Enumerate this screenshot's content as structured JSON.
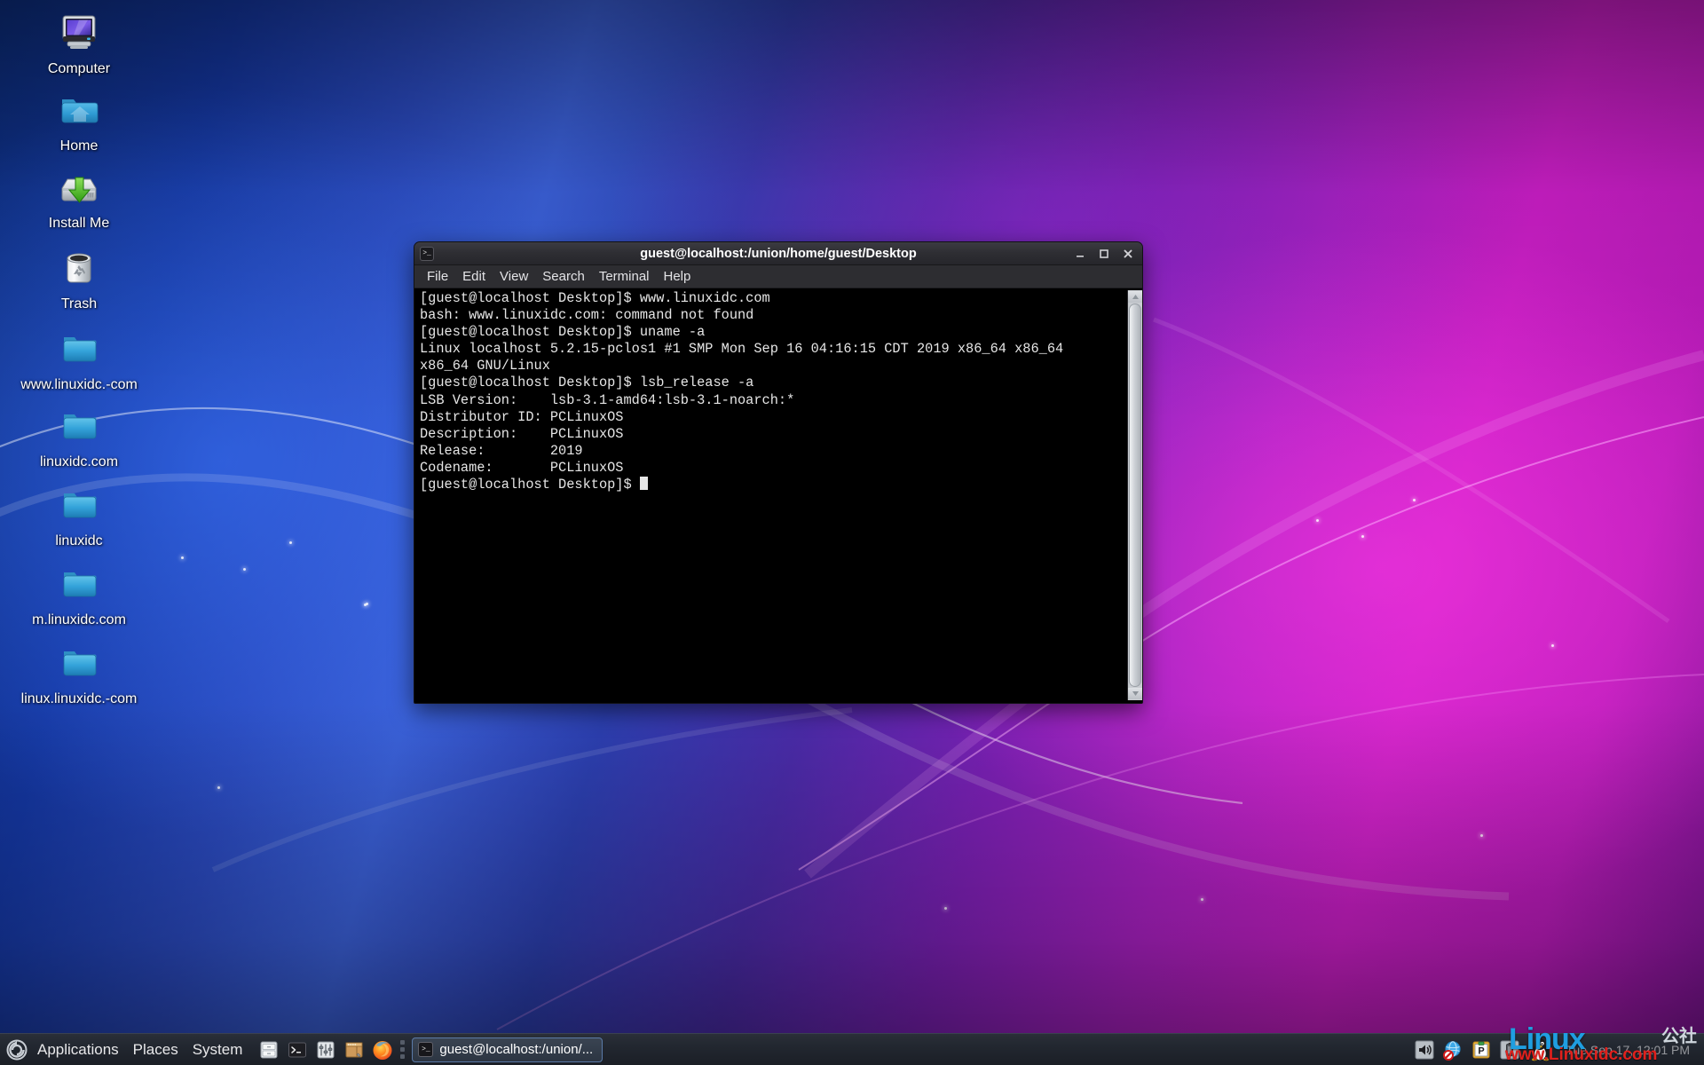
{
  "desktop": {
    "icons": [
      {
        "label": "Computer",
        "icon": "computer-monitor-icon"
      },
      {
        "label": "Home",
        "icon": "home-folder-icon"
      },
      {
        "label": "Install Me",
        "icon": "install-harddrive-icon"
      },
      {
        "label": "Trash",
        "icon": "trash-bin-icon"
      },
      {
        "label": "www.linuxidc.-com",
        "icon": "folder-icon"
      },
      {
        "label": "linuxidc.com",
        "icon": "folder-icon"
      },
      {
        "label": "linuxidc",
        "icon": "folder-icon"
      },
      {
        "label": "m.linuxidc.com",
        "icon": "folder-icon"
      },
      {
        "label": "linux.linuxidc.-com",
        "icon": "folder-icon"
      }
    ]
  },
  "terminal": {
    "title": "guest@localhost:/union/home/guest/Desktop",
    "window_icon": "terminal-icon",
    "titlebar_buttons": [
      {
        "name": "minimize",
        "glyph": "_"
      },
      {
        "name": "maximize",
        "glyph": "□"
      },
      {
        "name": "close",
        "glyph": "✕"
      }
    ],
    "menu": [
      "File",
      "Edit",
      "View",
      "Search",
      "Terminal",
      "Help"
    ],
    "content": "[guest@localhost Desktop]$ www.linuxidc.com\nbash: www.linuxidc.com: command not found\n[guest@localhost Desktop]$ uname -a\nLinux localhost 5.2.15-pclos1 #1 SMP Mon Sep 16 04:16:15 CDT 2019 x86_64 x86_64\nx86_64 GNU/Linux\n[guest@localhost Desktop]$ lsb_release -a\nLSB Version:    lsb-3.1-amd64:lsb-3.1-noarch:*\nDistributor ID: PCLinuxOS\nDescription:    PCLinuxOS\nRelease:        2019\nCodename:       PCLinuxOS\n[guest@localhost Desktop]$ ",
    "colors": {
      "background": "#000000",
      "foreground": "#e6e6e6"
    }
  },
  "taskbar": {
    "logo": "pclinuxos-swirl-icon",
    "menus": [
      "Applications",
      "Places",
      "System"
    ],
    "launchers": [
      {
        "name": "file-manager-icon"
      },
      {
        "name": "terminal-icon"
      },
      {
        "name": "mixer-equalizer-icon"
      },
      {
        "name": "package-manager-icon"
      },
      {
        "name": "firefox-icon"
      }
    ],
    "window_button": {
      "label": "guest@localhost:/union/...",
      "icon": "terminal-icon"
    },
    "tray": [
      {
        "name": "volume-speaker-icon"
      },
      {
        "name": "network-disconnected-icon"
      },
      {
        "name": "clipboard-icon"
      },
      {
        "name": "battery-icon"
      },
      {
        "name": "tux-penguin-icon"
      }
    ],
    "clock": "Tue Sep 17, 12:01 PM"
  },
  "watermark": {
    "brand": "Linux",
    "brand_cn": "公社",
    "url": "www.Linuxidc.com",
    "brand_color": "#1f9ee0",
    "url_color": "#e0201c"
  }
}
